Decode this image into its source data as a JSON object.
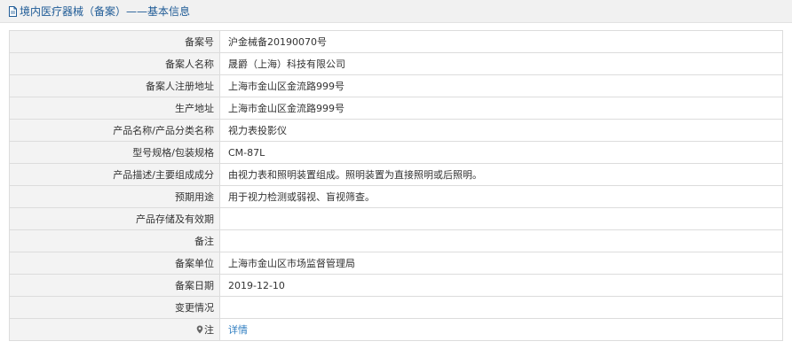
{
  "header": {
    "title": "境内医疗器械（备案）——基本信息",
    "icon": "document-icon"
  },
  "rows": [
    {
      "key": "record_number",
      "label": "备案号",
      "value": "沪金械备20190070号"
    },
    {
      "key": "registrant_name",
      "label": "备案人名称",
      "value": "晟爵（上海）科技有限公司"
    },
    {
      "key": "registrant_address",
      "label": "备案人注册地址",
      "value": "上海市金山区金流路999号"
    },
    {
      "key": "production_address",
      "label": "生产地址",
      "value": "上海市金山区金流路999号"
    },
    {
      "key": "product_name",
      "label": "产品名称/产品分类名称",
      "value": "视力表投影仪"
    },
    {
      "key": "model_spec",
      "label": "型号规格/包装规格",
      "value": "CM-87L"
    },
    {
      "key": "description",
      "label": "产品描述/主要组成成分",
      "value": "由视力表和照明装置组成。照明装置为直接照明或后照明。"
    },
    {
      "key": "intended_use",
      "label": "预期用途",
      "value": "用于视力检测或弱视、盲视筛查。"
    },
    {
      "key": "storage_validity",
      "label": "产品存储及有效期",
      "value": ""
    },
    {
      "key": "remarks",
      "label": "备注",
      "value": ""
    },
    {
      "key": "record_unit",
      "label": "备案单位",
      "value": "上海市金山区市场监督管理局"
    },
    {
      "key": "record_date",
      "label": "备案日期",
      "value": "2019-12-10"
    },
    {
      "key": "change_info",
      "label": "变更情况",
      "value": ""
    }
  ],
  "note_row": {
    "label": "注",
    "icon": "location-pin-icon",
    "link_text": "详情"
  },
  "colors": {
    "title": "#1f5b96",
    "label_bg": "#f3f3f3",
    "border": "#dcdcdc",
    "link": "#2f7ec1"
  }
}
